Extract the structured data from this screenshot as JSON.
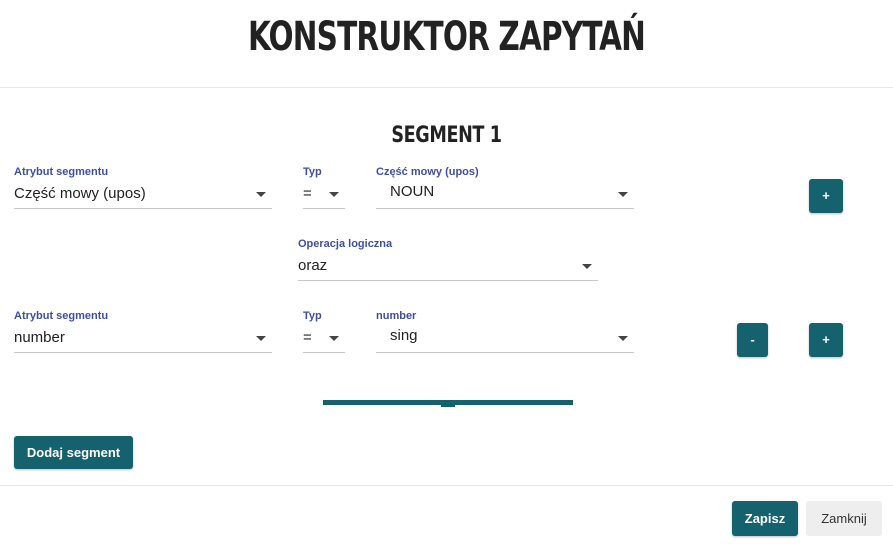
{
  "dialog": {
    "title": "KONSTRUKTOR ZAPYTAŃ"
  },
  "segment": {
    "title": "SEGMENT 1",
    "rows": [
      {
        "attribute_label": "Atrybut segmentu",
        "attribute_value": "Część mowy (upos)",
        "type_label": "Typ",
        "type_value": "=",
        "value_label": "Część mowy (upos)",
        "value_value": "NOUN",
        "add_label": "+"
      },
      {
        "attribute_label": "Atrybut segmentu",
        "attribute_value": "number",
        "type_label": "Typ",
        "type_value": "=",
        "value_label": "number",
        "value_value": "sing",
        "remove_label": "-",
        "add_label": "+"
      }
    ],
    "logic": {
      "label": "Operacja logiczna",
      "value": "oraz"
    }
  },
  "actions": {
    "add_segment": "Dodaj segment",
    "save": "Zapisz",
    "close": "Zamknij"
  },
  "colors": {
    "accent": "#15616d",
    "label": "#3f4fa0"
  }
}
